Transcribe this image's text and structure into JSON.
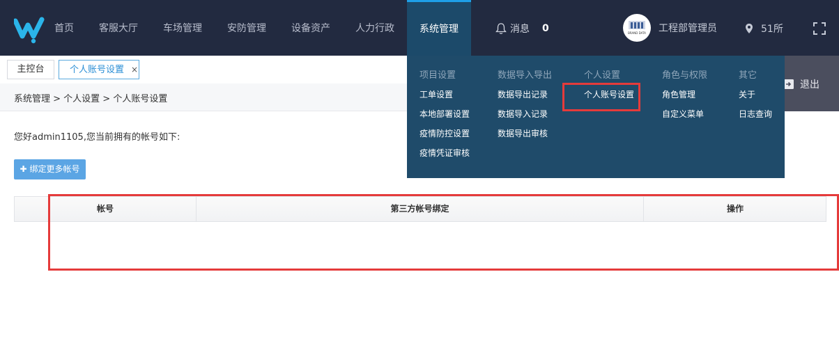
{
  "header": {
    "nav": [
      "首页",
      "客服大厅",
      "车场管理",
      "安防管理",
      "设备资产",
      "人力行政",
      "系统管理"
    ],
    "active_nav": "系统管理",
    "messages_label": "消息",
    "messages_count": "0",
    "user_name": "工程部管理员",
    "location": "51所",
    "colors": {
      "bar": "#222a40",
      "active": "#1c4a6a",
      "accent": "#1ea0e8"
    }
  },
  "tabs": {
    "home": "主控台",
    "current": "个人账号设置",
    "close": "×"
  },
  "logout_label": "退出",
  "breadcrumb": "系统管理 > 个人设置 > 个人账号设置",
  "greeting": "您好admin1105,您当前拥有的帐号如下:",
  "bind_button": "绑定更多帐号",
  "table": {
    "headers": [
      "帐号",
      "第三方帐号绑定",
      "操作"
    ]
  },
  "dropdown": {
    "columns": [
      {
        "heading": "项目设置",
        "items": [
          "工单设置",
          "本地部署设置",
          "疫情防控设置",
          "疫情凭证审核"
        ]
      },
      {
        "heading": "数据导入导出",
        "items": [
          "数据导出记录",
          "数据导入记录",
          "数据导出审核"
        ]
      },
      {
        "heading": "个人设置",
        "items": [
          "个人账号设置"
        ]
      },
      {
        "heading": "角色与权限",
        "items": [
          "角色管理",
          "自定义菜单"
        ]
      },
      {
        "heading": "其它",
        "items": [
          "关于",
          "日志查询"
        ]
      }
    ]
  },
  "avatar_brand": "BRAND DATA"
}
